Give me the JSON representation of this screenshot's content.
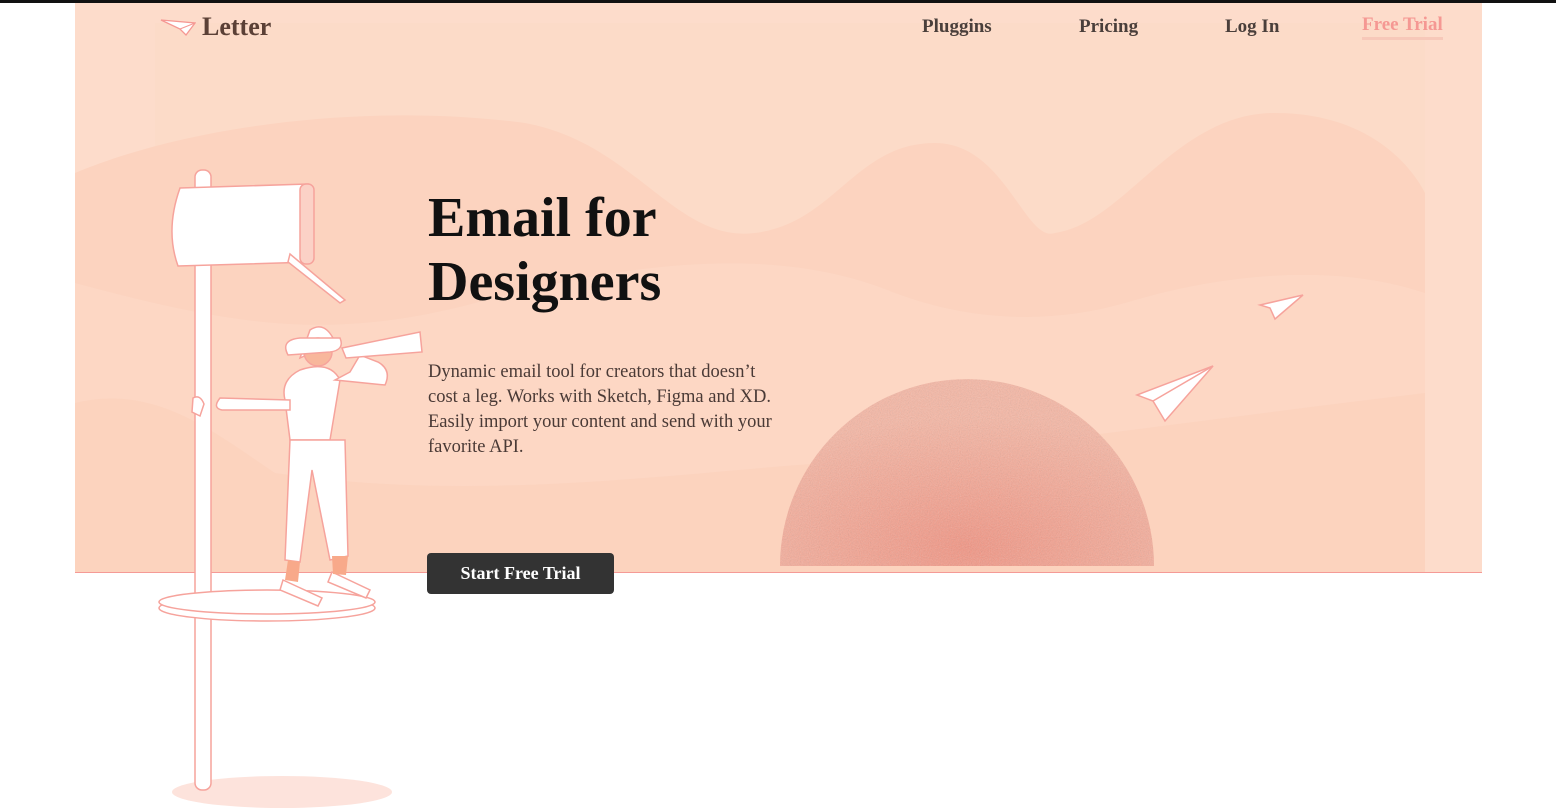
{
  "header": {
    "logo_text": "Letter",
    "nav": [
      {
        "label": "Pluggins"
      },
      {
        "label": "Pricing"
      },
      {
        "label": "Log In"
      },
      {
        "label": "Free Trial"
      }
    ]
  },
  "hero": {
    "title_line1": "Email for",
    "title_line2": "Designers",
    "description": "Dynamic email tool for creators that doesn’t cost a leg. Works with Sketch, Figma and XD. Easily import your content and send with your favorite API.",
    "cta_label": "Start Free Trial"
  },
  "colors": {
    "background": "#fddccb",
    "accent": "#f59893",
    "button": "#333333",
    "sun": "#f4a08e"
  }
}
